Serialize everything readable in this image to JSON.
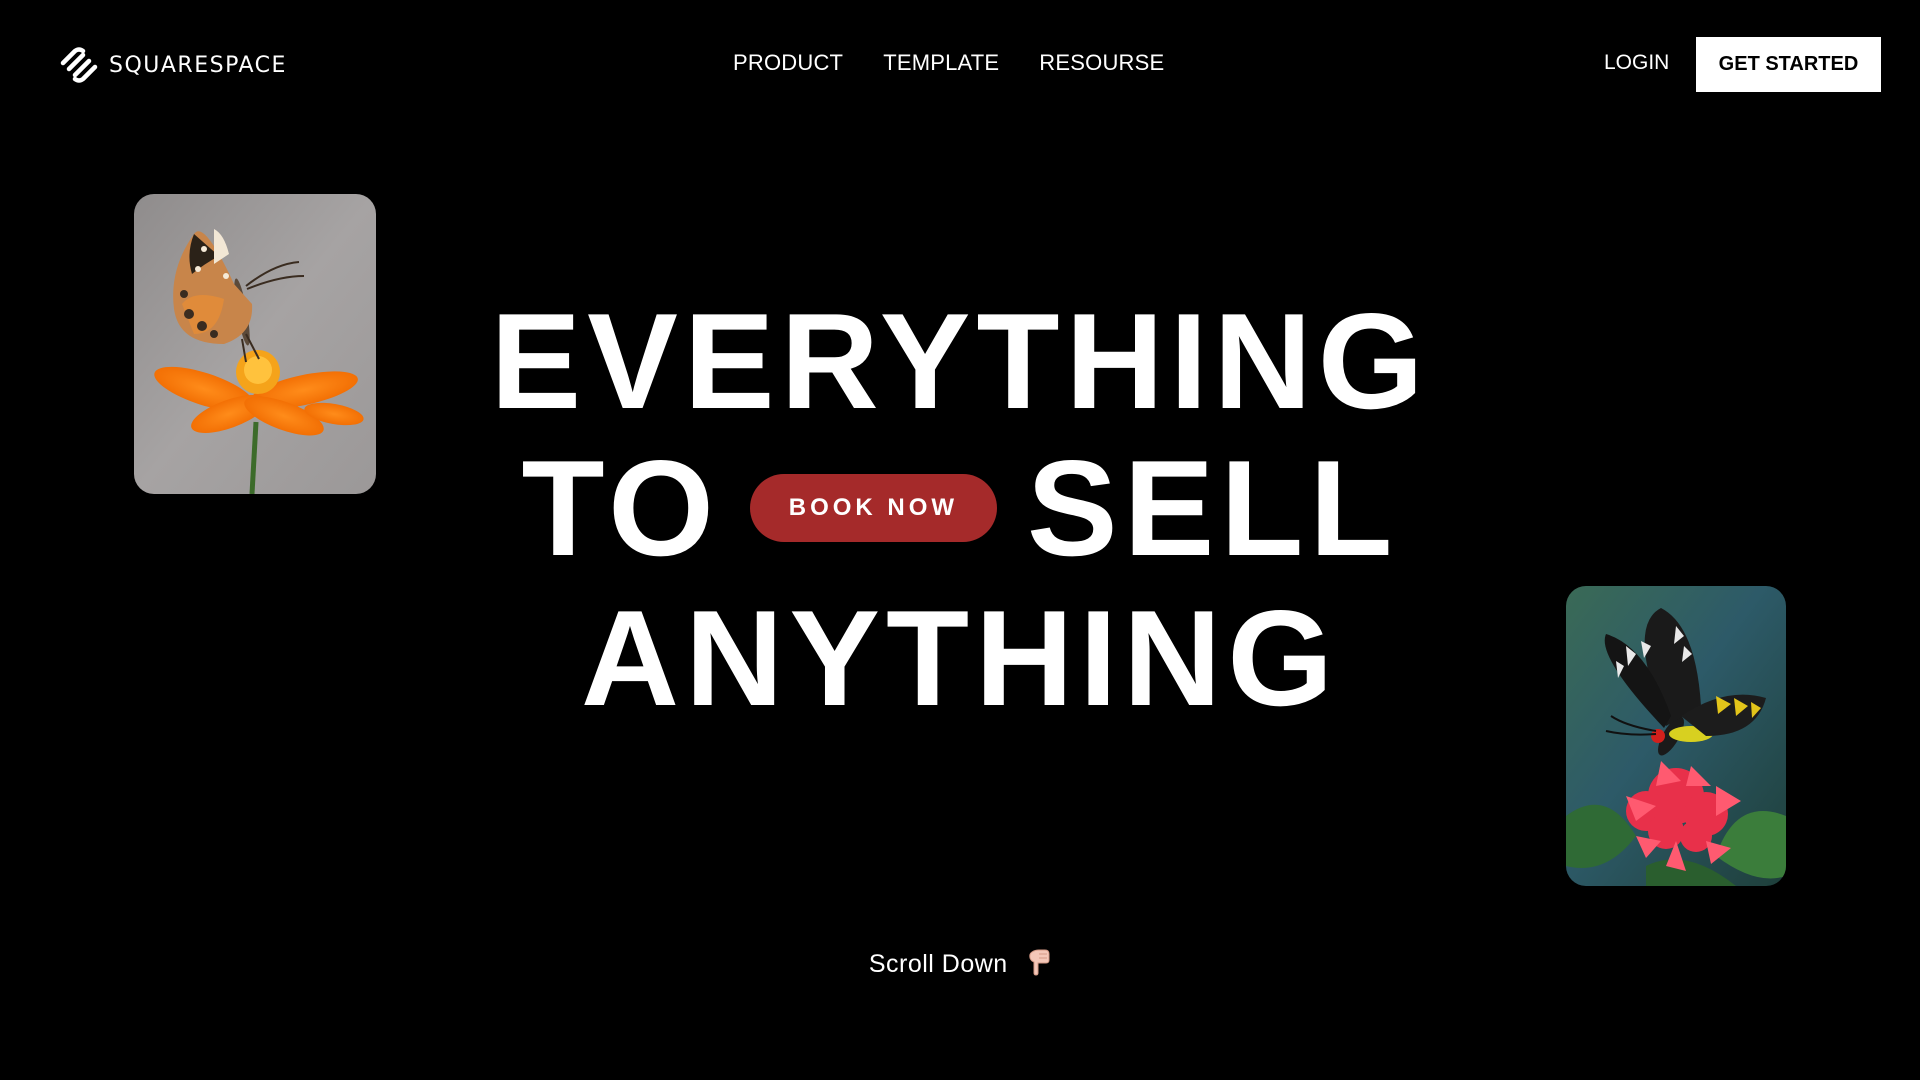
{
  "brand": {
    "name": "SQUARESPACE",
    "logo_icon": "squarespace-logo-icon"
  },
  "nav": {
    "items": [
      {
        "label": "PRODUCT"
      },
      {
        "label": "TEMPLATE"
      },
      {
        "label": "RESOURSE"
      }
    ]
  },
  "header_actions": {
    "login_label": "LOGIN",
    "get_started_label": "GET STARTED"
  },
  "hero": {
    "line1": "EVERYTHING",
    "line2_left": "TO",
    "line2_right": "SELL",
    "line3": "ANYTHING",
    "book_now_label": "BOOK NOW"
  },
  "images": {
    "left": "orange-butterfly-on-orange-flower",
    "right": "black-butterfly-on-red-flower"
  },
  "scroll": {
    "label": "Scroll Down",
    "icon": "pointing-down-hand-icon"
  },
  "colors": {
    "background": "#000000",
    "text": "#ffffff",
    "accent": "#a52a2a",
    "cta_background": "#ffffff"
  }
}
